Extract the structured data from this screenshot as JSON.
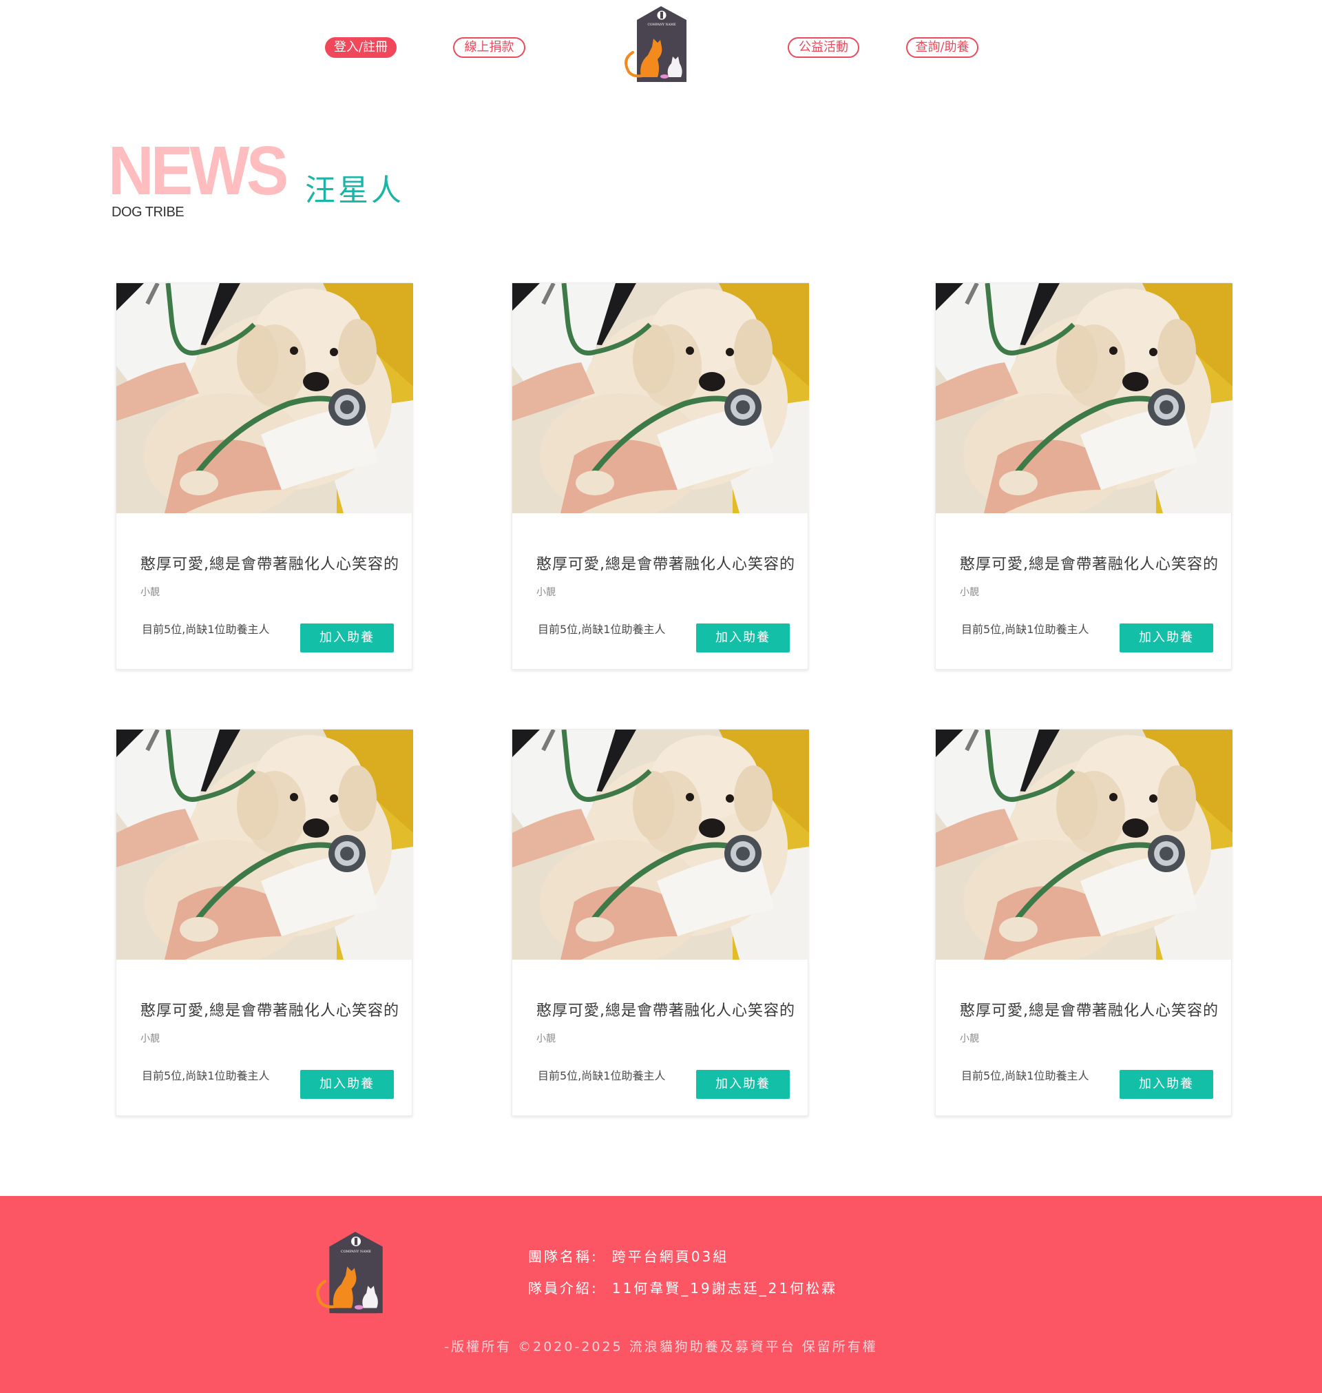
{
  "header": {
    "nav": [
      {
        "label": "登入/註冊",
        "style": "filled"
      },
      {
        "label": "線上捐款",
        "style": "outline"
      },
      {
        "label": "公益活動",
        "style": "outline"
      },
      {
        "label": "查詢/助養",
        "style": "outline"
      }
    ],
    "logo_text": "COMPANY NAME"
  },
  "section": {
    "heading": "NEWS",
    "subheading": "DOG TRIBE",
    "title_cn": "汪星人"
  },
  "cards": [
    {
      "title": "憨厚可愛,總是會帶著融化人心笑容的",
      "author": "小靚",
      "status": "目前5位,尚缺1位助養主人",
      "button": "加入助養"
    },
    {
      "title": "憨厚可愛,總是會帶著融化人心笑容的",
      "author": "小靚",
      "status": "目前5位,尚缺1位助養主人",
      "button": "加入助養"
    },
    {
      "title": "憨厚可愛,總是會帶著融化人心笑容的",
      "author": "小靚",
      "status": "目前5位,尚缺1位助養主人",
      "button": "加入助養"
    },
    {
      "title": "憨厚可愛,總是會帶著融化人心笑容的",
      "author": "小靚",
      "status": "目前5位,尚缺1位助養主人",
      "button": "加入助養"
    },
    {
      "title": "憨厚可愛,總是會帶著融化人心笑容的",
      "author": "小靚",
      "status": "目前5位,尚缺1位助養主人",
      "button": "加入助養"
    },
    {
      "title": "憨厚可愛,總是會帶著融化人心笑容的",
      "author": "小靚",
      "status": "目前5位,尚缺1位助養主人",
      "button": "加入助養"
    }
  ],
  "footer": {
    "team_label": "團隊名稱:",
    "team_value": "跨平台網頁03組",
    "members_label": "隊員介紹:",
    "members_value": "11何韋賢_19謝志廷_21何松霖",
    "copyright": "-版權所有 ©2020-2025 流浪貓狗助養及募資平台 保留所有權"
  },
  "colors": {
    "accent_pink": "#f0475a",
    "news_pink": "#ffbdbf",
    "teal": "#14bfa8",
    "footer_bg": "#fc5664",
    "logo_house": "#4a4350",
    "cat_orange": "#f28a1e"
  }
}
